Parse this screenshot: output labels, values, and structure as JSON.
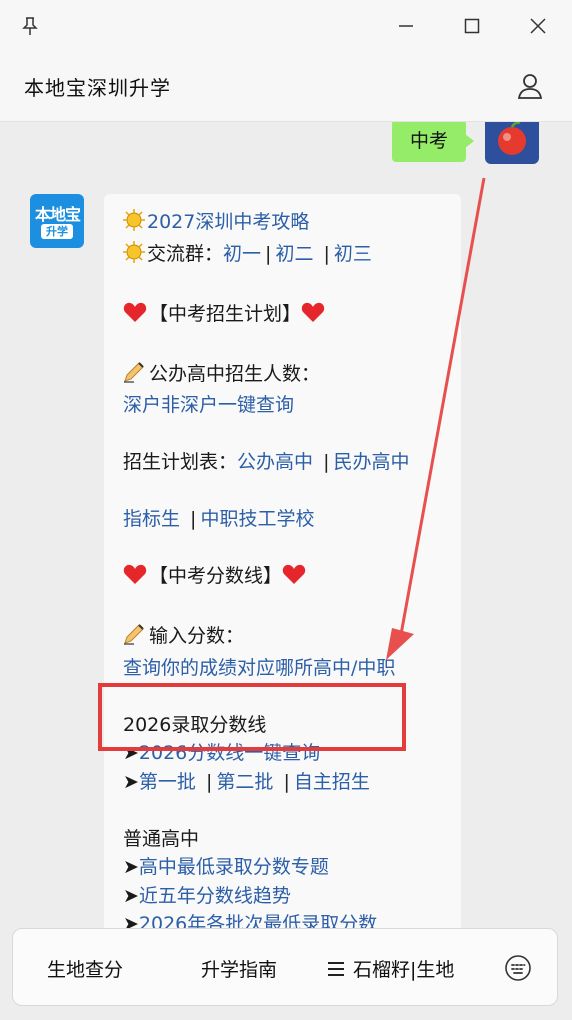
{
  "header": {
    "title": "本地宝深圳升学"
  },
  "avatars": {
    "bot_logo_main": "本地宝",
    "bot_logo_sub": "升学"
  },
  "chat": {
    "user_message": "中考",
    "bot": {
      "line1_link": "2027深圳中考攻略",
      "line2_label": "交流群：",
      "line2_links": [
        "初一",
        "初二",
        "初三"
      ],
      "section1_title": "【中考招生计划】",
      "public_label": "公办高中招生人数：",
      "public_link": "深户非深户一键查询",
      "plan_label": "招生计划表：",
      "plan_links": [
        "公办高中",
        "民办高中"
      ],
      "plan_links2": [
        "指标生",
        "中职技工学校"
      ],
      "section2_title": "【中考分数线】",
      "input_label": "输入分数：",
      "input_link": "查询你的成绩对应哪所高中/中职",
      "lines_2026_label": "2026录取分数线",
      "lines_2026_link": "2026分数线一键查询",
      "batch_links": [
        "第一批",
        "第二批",
        "自主招生"
      ],
      "general_label": "普通高中",
      "general_links": [
        "高中最低录取分数专题",
        "近五年分数线趋势",
        "2026年各批次最低录取分数"
      ]
    }
  },
  "bottom_menu": {
    "item1": "生地查分",
    "item2": "升学指南",
    "item3": "石榴籽|生地"
  },
  "colors": {
    "link": "#2c5fa8",
    "user_bubble": "#95ec69",
    "highlight": "#e23c3c"
  },
  "icons": [
    "pin-icon",
    "minimize-icon",
    "maximize-icon",
    "close-icon",
    "person-icon",
    "sun-icon",
    "heart-icon",
    "writing-hand-icon",
    "arrow-icon",
    "hamburger-icon",
    "keyboard-icon"
  ]
}
